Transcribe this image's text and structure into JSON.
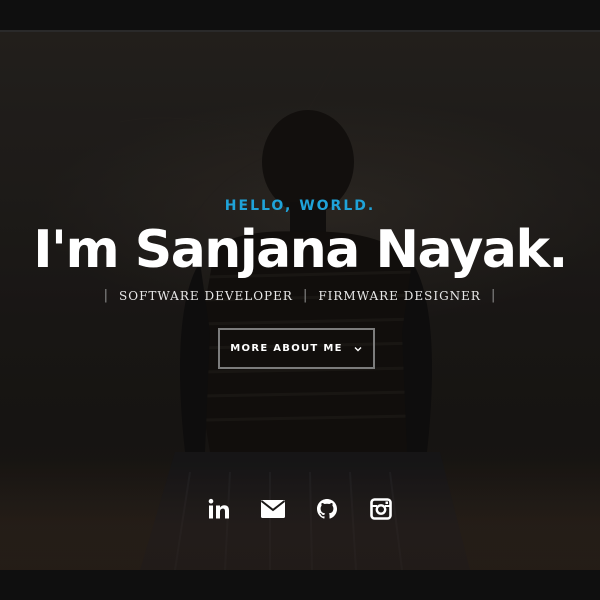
{
  "hero": {
    "eyebrow": "HELLO, WORLD.",
    "headline": "I'm Sanjana Nayak.",
    "roles": [
      "SOFTWARE DEVELOPER",
      "FIRMWARE DESIGNER"
    ],
    "separator": "|",
    "cta": {
      "label": "MORE ABOUT ME",
      "icon": "chevron-down-icon"
    },
    "accent_color": "#1fa3d9"
  },
  "socials": [
    {
      "name": "linkedin",
      "icon": "linkedin-icon"
    },
    {
      "name": "email",
      "icon": "mail-icon"
    },
    {
      "name": "github",
      "icon": "github-icon"
    },
    {
      "name": "instagram",
      "icon": "instagram-icon"
    }
  ]
}
